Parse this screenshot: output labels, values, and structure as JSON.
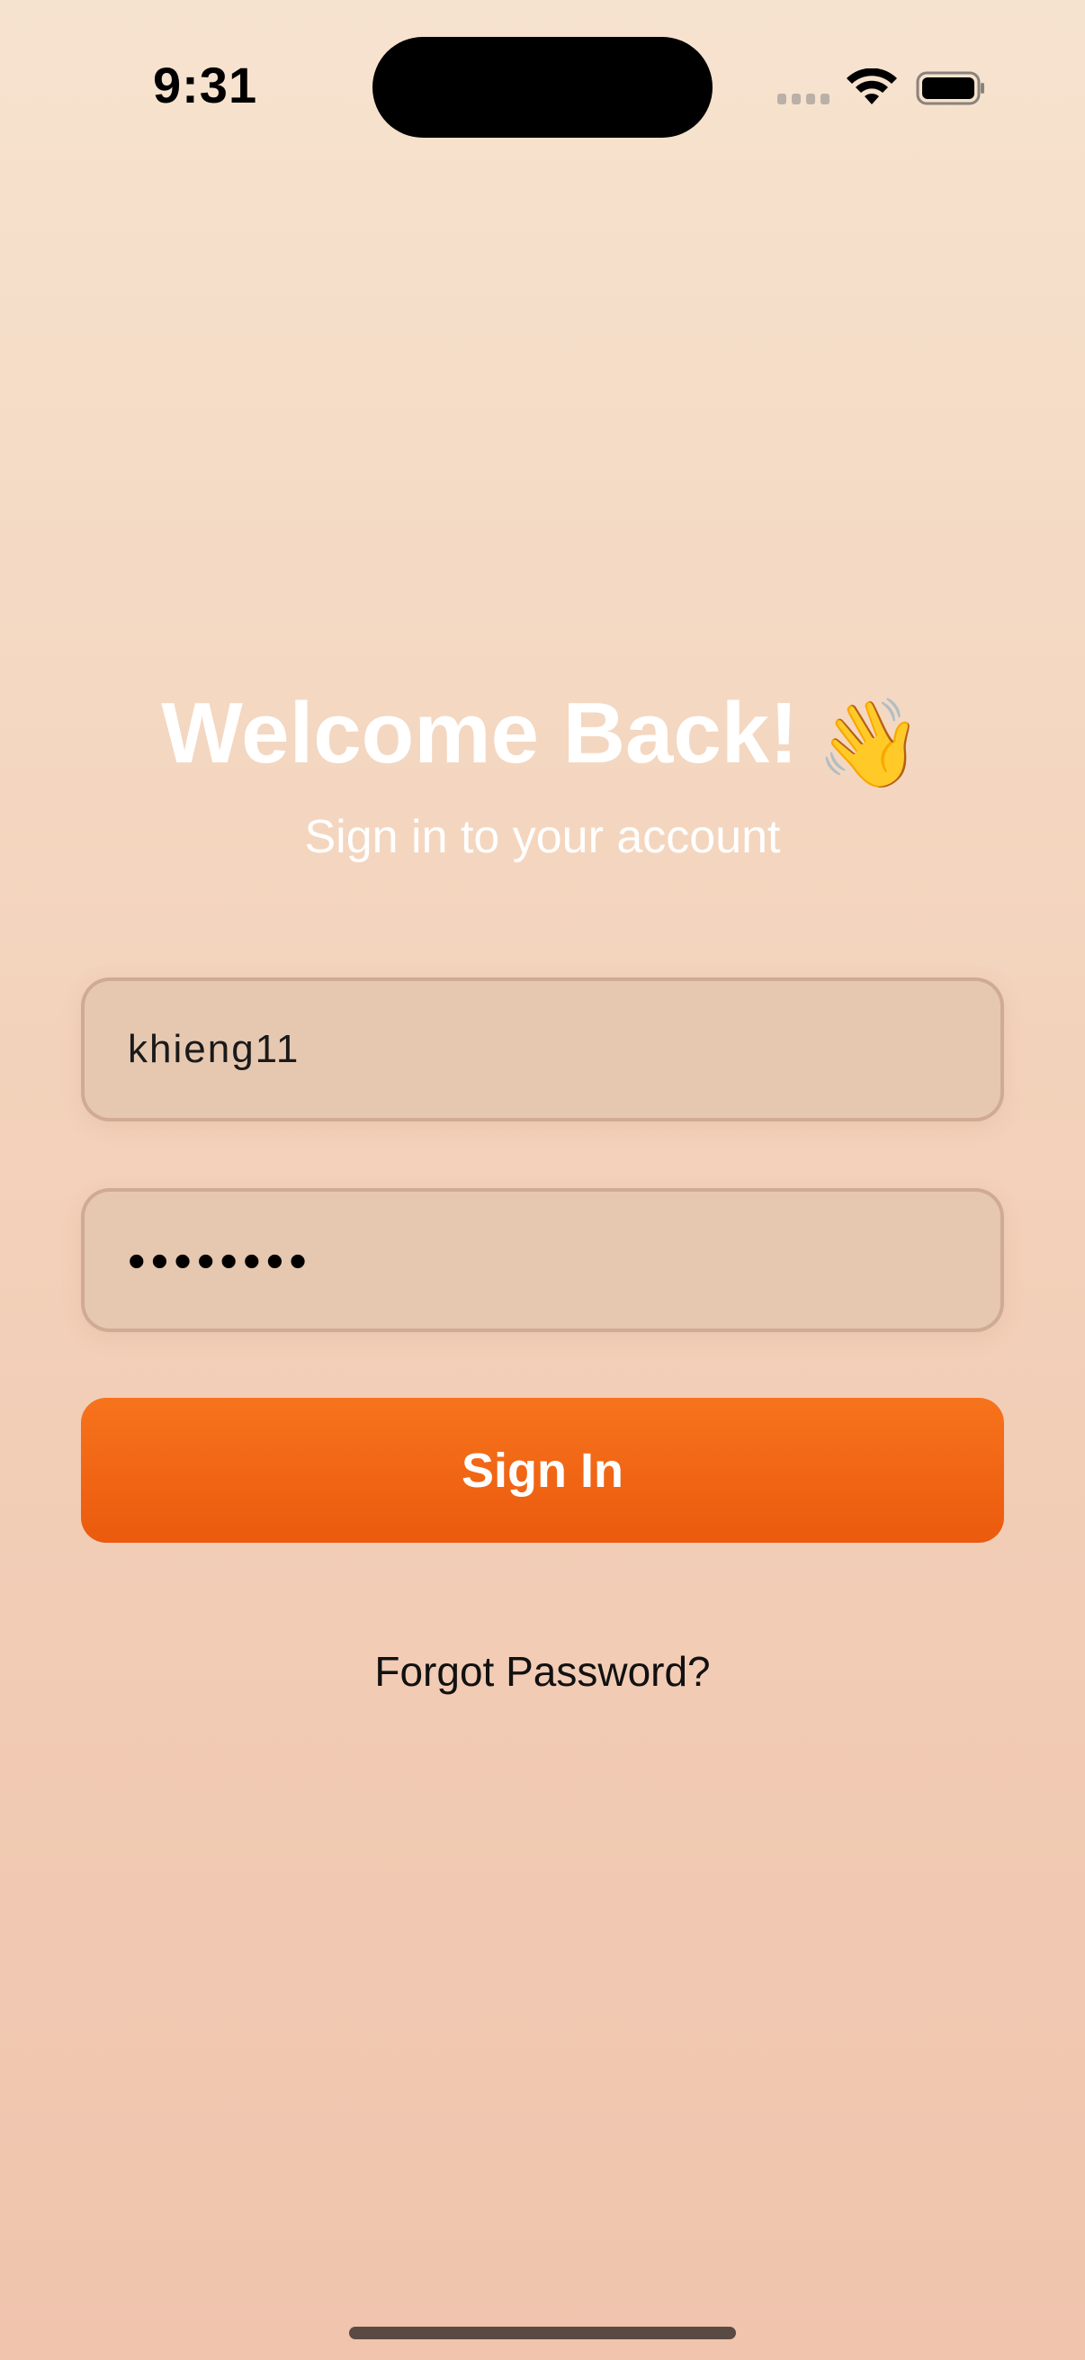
{
  "status_bar": {
    "time": "9:31",
    "icons": [
      "cellular-signal-icon",
      "wifi-icon",
      "battery-icon"
    ]
  },
  "header": {
    "title": "Welcome Back!",
    "title_emoji": "👋",
    "subtitle": "Sign in to your account"
  },
  "form": {
    "username_value": "khieng11",
    "password_value": "••••••••",
    "sign_in_label": "Sign In",
    "forgot_password_label": "Forgot Password?"
  },
  "colors": {
    "accent": "#f26a17",
    "background_top": "#f6e3cf",
    "background_bottom": "#f0c4ad"
  }
}
